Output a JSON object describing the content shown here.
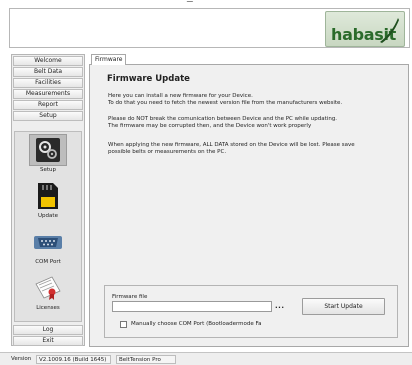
{
  "header": {
    "logo_text": "habasit"
  },
  "sidebar": {
    "items": [
      {
        "label": "Welcome"
      },
      {
        "label": "Belt Data"
      },
      {
        "label": "Facilities"
      },
      {
        "label": "Measurements"
      },
      {
        "label": "Report"
      },
      {
        "label": "Setup"
      }
    ],
    "tools": [
      {
        "label": "Setup",
        "icon": "gear-icon",
        "selected": true
      },
      {
        "label": "Update",
        "icon": "memory-card-icon"
      },
      {
        "label": "COM Port",
        "icon": "serial-port-icon"
      },
      {
        "label": "Licenses",
        "icon": "certificate-icon"
      }
    ],
    "bottom_items": [
      {
        "label": "Log"
      },
      {
        "label": "Exit"
      }
    ]
  },
  "tab": {
    "label": "Firmware"
  },
  "main": {
    "title": "Firmware Update",
    "para1": [
      "Here you can install a new firmware for your Device.",
      "To do that you need to fetch the newest version file from the manufacturers website."
    ],
    "para2": [
      "Please do NOT break the comunication between Device and the PC while updating.",
      "The firmware may be corrupted then, and the Device won't work properly"
    ],
    "para3": [
      "When applying the new firmware, ALL DATA stored on the Device will be lost. Please save",
      "possible belts or measurements on the PC."
    ],
    "firmware_file_label": "Firmware file",
    "firmware_file_value": "",
    "browse_label": "...",
    "start_update_label": "Start Update",
    "manual_com_label": "Manually choose COM Port (Bootloadermode Fa",
    "manual_com_checked": false
  },
  "statusbar": {
    "version_label": "Version",
    "version_value": "V2.1009.16 (Build 1645)",
    "app_name": "BeltTension Pro"
  },
  "colors": {
    "brand_green": "#2b6b2b",
    "panel_bg": "#f0f0f0"
  }
}
